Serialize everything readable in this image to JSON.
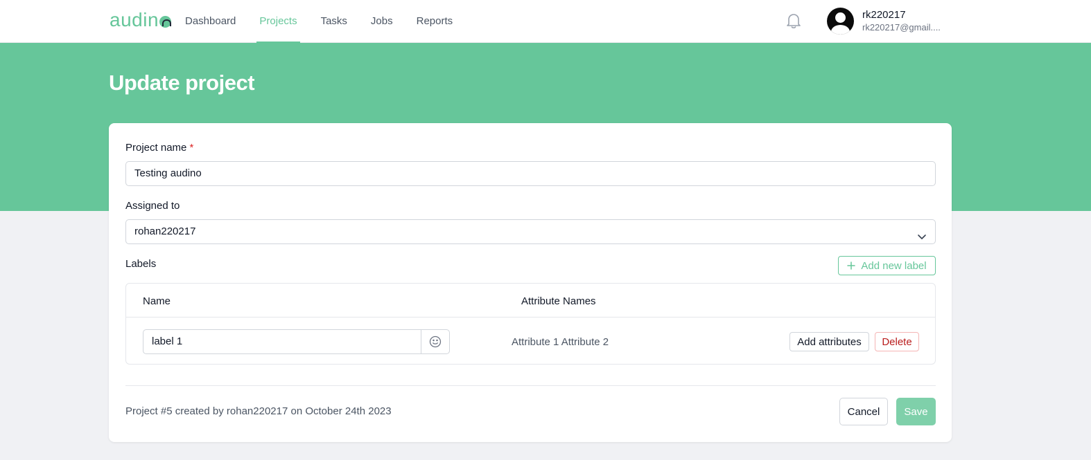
{
  "app": {
    "logo_text": "audin"
  },
  "nav": {
    "items": [
      {
        "label": "Dashboard",
        "active": false
      },
      {
        "label": "Projects",
        "active": true
      },
      {
        "label": "Tasks",
        "active": false
      },
      {
        "label": "Jobs",
        "active": false
      },
      {
        "label": "Reports",
        "active": false
      }
    ]
  },
  "user": {
    "name": "rk220217",
    "email": "rk220217@gmail...."
  },
  "page": {
    "title": "Update project"
  },
  "form": {
    "project_name_label": "Project name",
    "required_mark": "*",
    "project_name_value": "Testing audino",
    "assigned_to_label": "Assigned to",
    "assigned_to_value": "rohan220217",
    "labels_heading": "Labels",
    "add_label_button": "Add new label",
    "table": {
      "col_name": "Name",
      "col_attributes": "Attribute Names",
      "rows": [
        {
          "name": "label 1",
          "attributes": "Attribute 1 Attribute 2",
          "add_attributes_button": "Add attributes",
          "delete_button": "Delete"
        }
      ]
    },
    "footer_text": "Project #5 created by rohan220217 on October 24th 2023",
    "cancel_button": "Cancel",
    "save_button": "Save"
  },
  "icons": {
    "notification": "bell-icon",
    "avatar": "user-avatar-icon",
    "select": "chevron-down-icon",
    "add": "plus-icon",
    "emoji": "smiley-icon"
  },
  "colors": {
    "brand": "#66c69a",
    "danger": "#b91c1c",
    "save_disabled": "#7fd0aa"
  }
}
